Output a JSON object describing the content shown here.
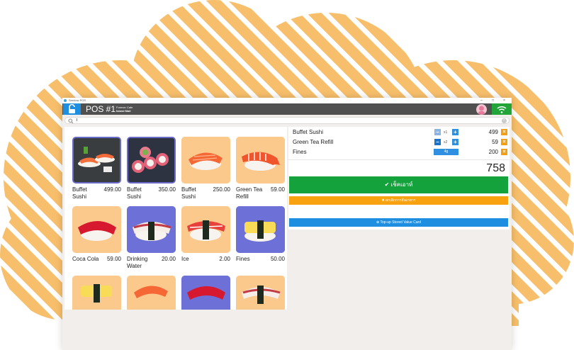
{
  "window": {
    "title": "Seedow POS"
  },
  "header": {
    "terminal": "POS #1",
    "store": "Forever Cafe",
    "mall": "Island Mall"
  },
  "search": {
    "value": "I"
  },
  "products": [
    {
      "name": "Buffet Sushi",
      "price": "499.00"
    },
    {
      "name": "Buffet Sushi",
      "price": "350.00"
    },
    {
      "name": "Buffet Sushi",
      "price": "250.00"
    },
    {
      "name": "Green Tea Refill",
      "price": "59.00"
    },
    {
      "name": "Coca Cola",
      "price": "59.00"
    },
    {
      "name": "Drinking Water",
      "price": "20.00"
    },
    {
      "name": "Ice",
      "price": "2.00"
    },
    {
      "name": "Fines",
      "price": "50.00"
    }
  ],
  "cart": {
    "items": [
      {
        "name": "Buffet Sushi",
        "qty": "x1",
        "price": "499"
      },
      {
        "name": "Green Tea Refill",
        "qty": "x2",
        "price": "59"
      },
      {
        "name": "Fines",
        "tag": "4g",
        "price": "200"
      }
    ],
    "total": "758",
    "checkout_label": "เช็คเอาท์",
    "cancel_label": "ยกเลิกการสั่งอาหาร",
    "topup_label": "Top-up Stored Value Card"
  },
  "colors": {
    "header_bg": "#505050",
    "primary_blue": "#1e8fe0",
    "checkout_green": "#14a23c",
    "cancel_orange": "#f8a20f",
    "background_stripes": "#f7bf6b"
  }
}
